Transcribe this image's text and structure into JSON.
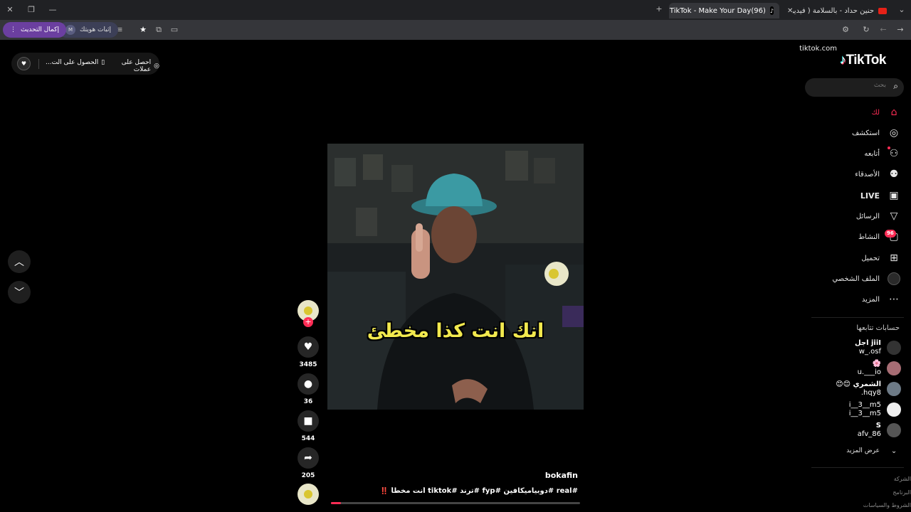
{
  "browser": {
    "tabs": [
      {
        "title": "حنين حداد - بالسلامة ( فيديو كليب...",
        "active": false
      },
      {
        "title": "(96)TikTok - Make Your Day",
        "active": true
      }
    ],
    "new_tab": "+",
    "url": "tiktok.com",
    "update_label": "إكمال التحديث",
    "identity_label": "إثبات هويتك"
  },
  "top_promo": {
    "coins_label": "احصل على عملات",
    "app_label": "الحصول على الت..."
  },
  "sidebar": {
    "logo": "TikTok",
    "search_placeholder": "بحث",
    "nav": [
      {
        "label": "لك",
        "icon": "home-icon",
        "active": true
      },
      {
        "label": "استكشف",
        "icon": "compass-icon"
      },
      {
        "label": "أتابعه",
        "icon": "following-icon"
      },
      {
        "label": "الأصدقاء",
        "icon": "friends-icon"
      },
      {
        "label": "LIVE",
        "icon": "live-icon"
      },
      {
        "label": "الرسائل",
        "icon": "messages-icon"
      },
      {
        "label": "النشاط",
        "icon": "activity-icon",
        "badge": "96"
      },
      {
        "label": "تحميل",
        "icon": "upload-icon"
      },
      {
        "label": "الملف الشخصي",
        "icon": "profile-icon"
      },
      {
        "label": "المزيد",
        "icon": "more-icon"
      }
    ],
    "following_title": "حسابات تتابعها",
    "following": [
      {
        "line1": "jiiI اجل",
        "line2": "w_.osf"
      },
      {
        "line1": "🌸",
        "line2": "u.___io"
      },
      {
        "line1": "الشمري 😊😊",
        "line2": "hqy8."
      },
      {
        "line1": "i__3__m5",
        "line2": "i__3__m5"
      },
      {
        "line1": "S",
        "line2": "afv_86"
      }
    ],
    "see_more": "عرض المزيد",
    "footer": [
      "الشركة",
      "البرنامج",
      "الشروط والسياسات"
    ]
  },
  "video": {
    "caption_overlay": "انك انت كذا مخطئ",
    "username": "bokafin",
    "description": "#real #دوبياميكافين #fyp #ترند #tiktok أنت مخطأ ‼️",
    "likes": "3485",
    "comments": "36",
    "saves": "544",
    "shares": "205",
    "progress": 0.04
  },
  "colors": {
    "accent": "#fe2c55",
    "caption_yellow": "#f2e94e"
  }
}
